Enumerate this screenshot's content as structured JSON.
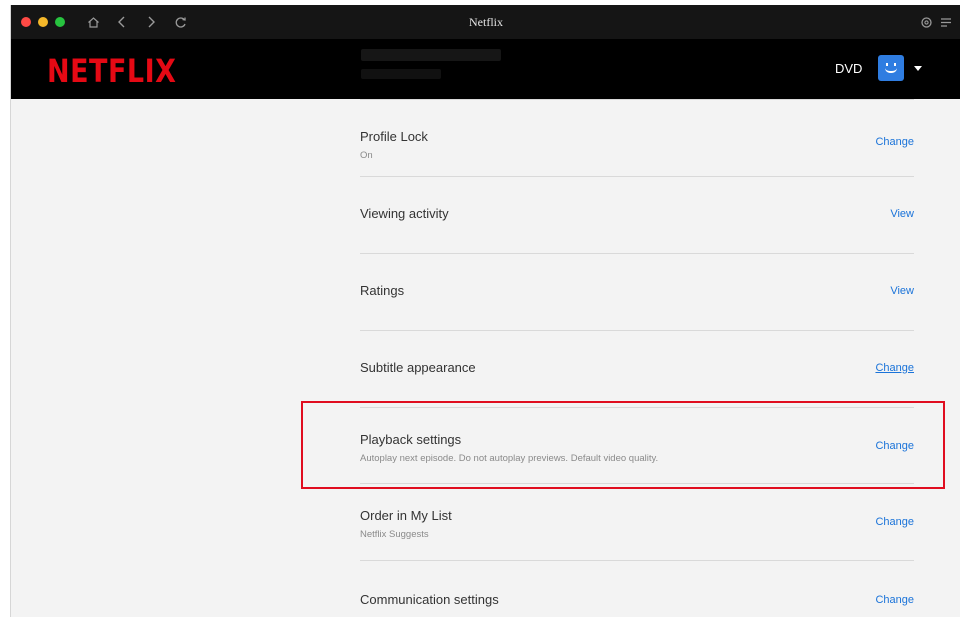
{
  "window": {
    "title": "Netflix"
  },
  "header": {
    "logo": "NETFLIX",
    "profile_name": "DVD"
  },
  "settings": [
    {
      "label": "Profile Lock",
      "sub": "On",
      "action": "Change"
    },
    {
      "label": "Viewing activity",
      "sub": "",
      "action": "View"
    },
    {
      "label": "Ratings",
      "sub": "",
      "action": "View"
    },
    {
      "label": "Subtitle appearance",
      "sub": "",
      "action": "Change"
    },
    {
      "label": "Playback settings",
      "sub": "Autoplay next episode. Do not autoplay previews. Default video quality.",
      "action": "Change"
    },
    {
      "label": "Order in My List",
      "sub": "Netflix Suggests",
      "action": "Change"
    },
    {
      "label": "Communication settings",
      "sub": "",
      "action": "Change"
    }
  ],
  "colors": {
    "brand": "#e50914",
    "link": "#1a73d9",
    "highlight": "#e00d1f",
    "header_bg": "#000000"
  }
}
